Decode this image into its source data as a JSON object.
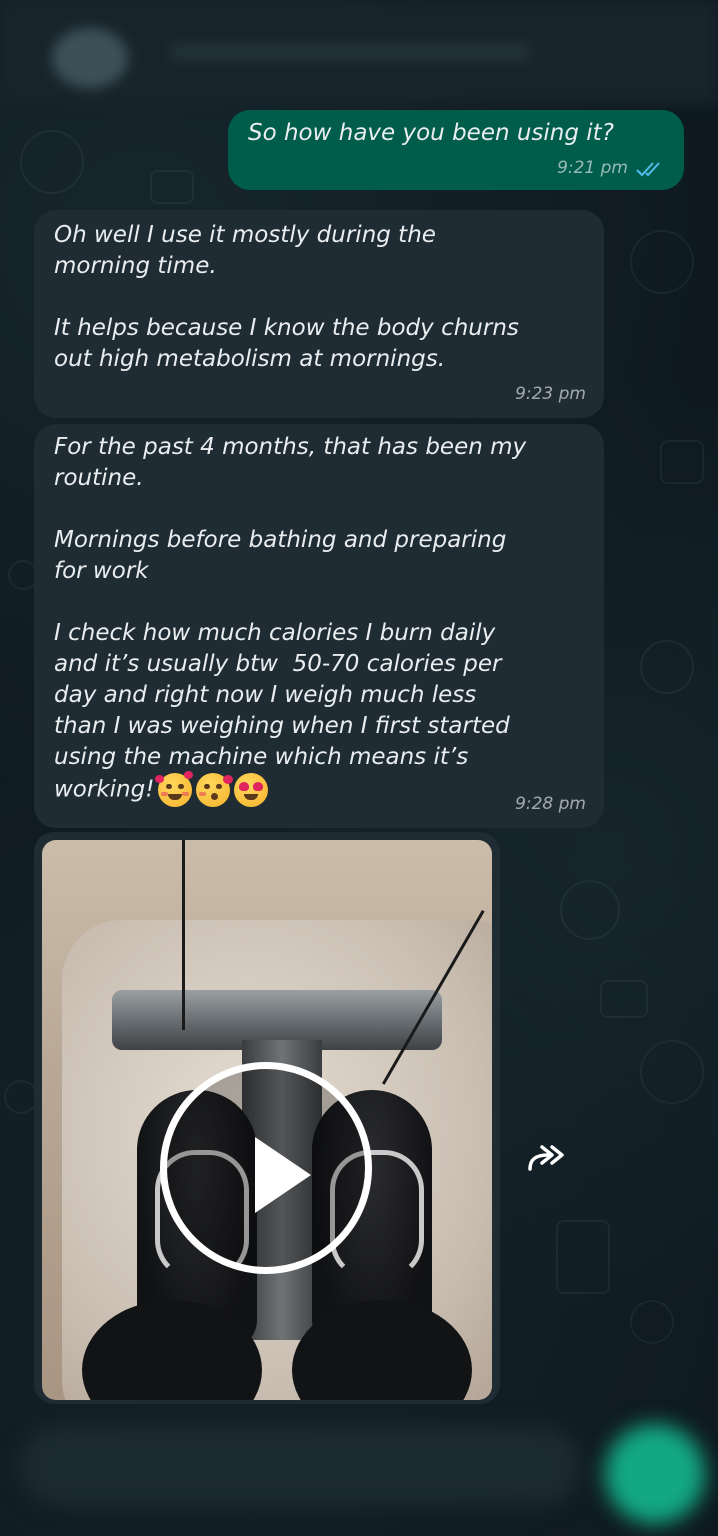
{
  "messages": [
    {
      "direction": "outgoing",
      "text": "So how have you been using it?",
      "time": "9:21 pm",
      "status": "read"
    },
    {
      "direction": "incoming",
      "text": "Oh well I use it mostly during the\nmorning time.\n\nIt helps because I know the body churns\nout high metabolism at mornings.",
      "time": "9:23 pm"
    },
    {
      "direction": "incoming",
      "text": "For the past 4 months, that has been my\nroutine.\n\nMornings before bathing and preparing\nfor work\n\nI check how much calories I burn daily\nand it’s usually btw  50-70 calories per\nday and right now I weigh much less\nthan I was weighing when I first started\nusing the machine which means it’s\nworking!",
      "time": "9:28 pm",
      "emojis": [
        "smiling-face-with-hearts",
        "face-blowing-a-kiss",
        "smiling-face-with-heart-eyes"
      ]
    }
  ],
  "video": {
    "icon": "play-icon"
  },
  "forward": {
    "icon": "forward-icon"
  },
  "colors": {
    "background": "#0b141a",
    "outgoing_bubble": "#005c4b",
    "incoming_bubble": "#1f2c33",
    "text": "#e9edef",
    "read_ticks": "#53bdeb",
    "mic_button": "#13a884"
  }
}
